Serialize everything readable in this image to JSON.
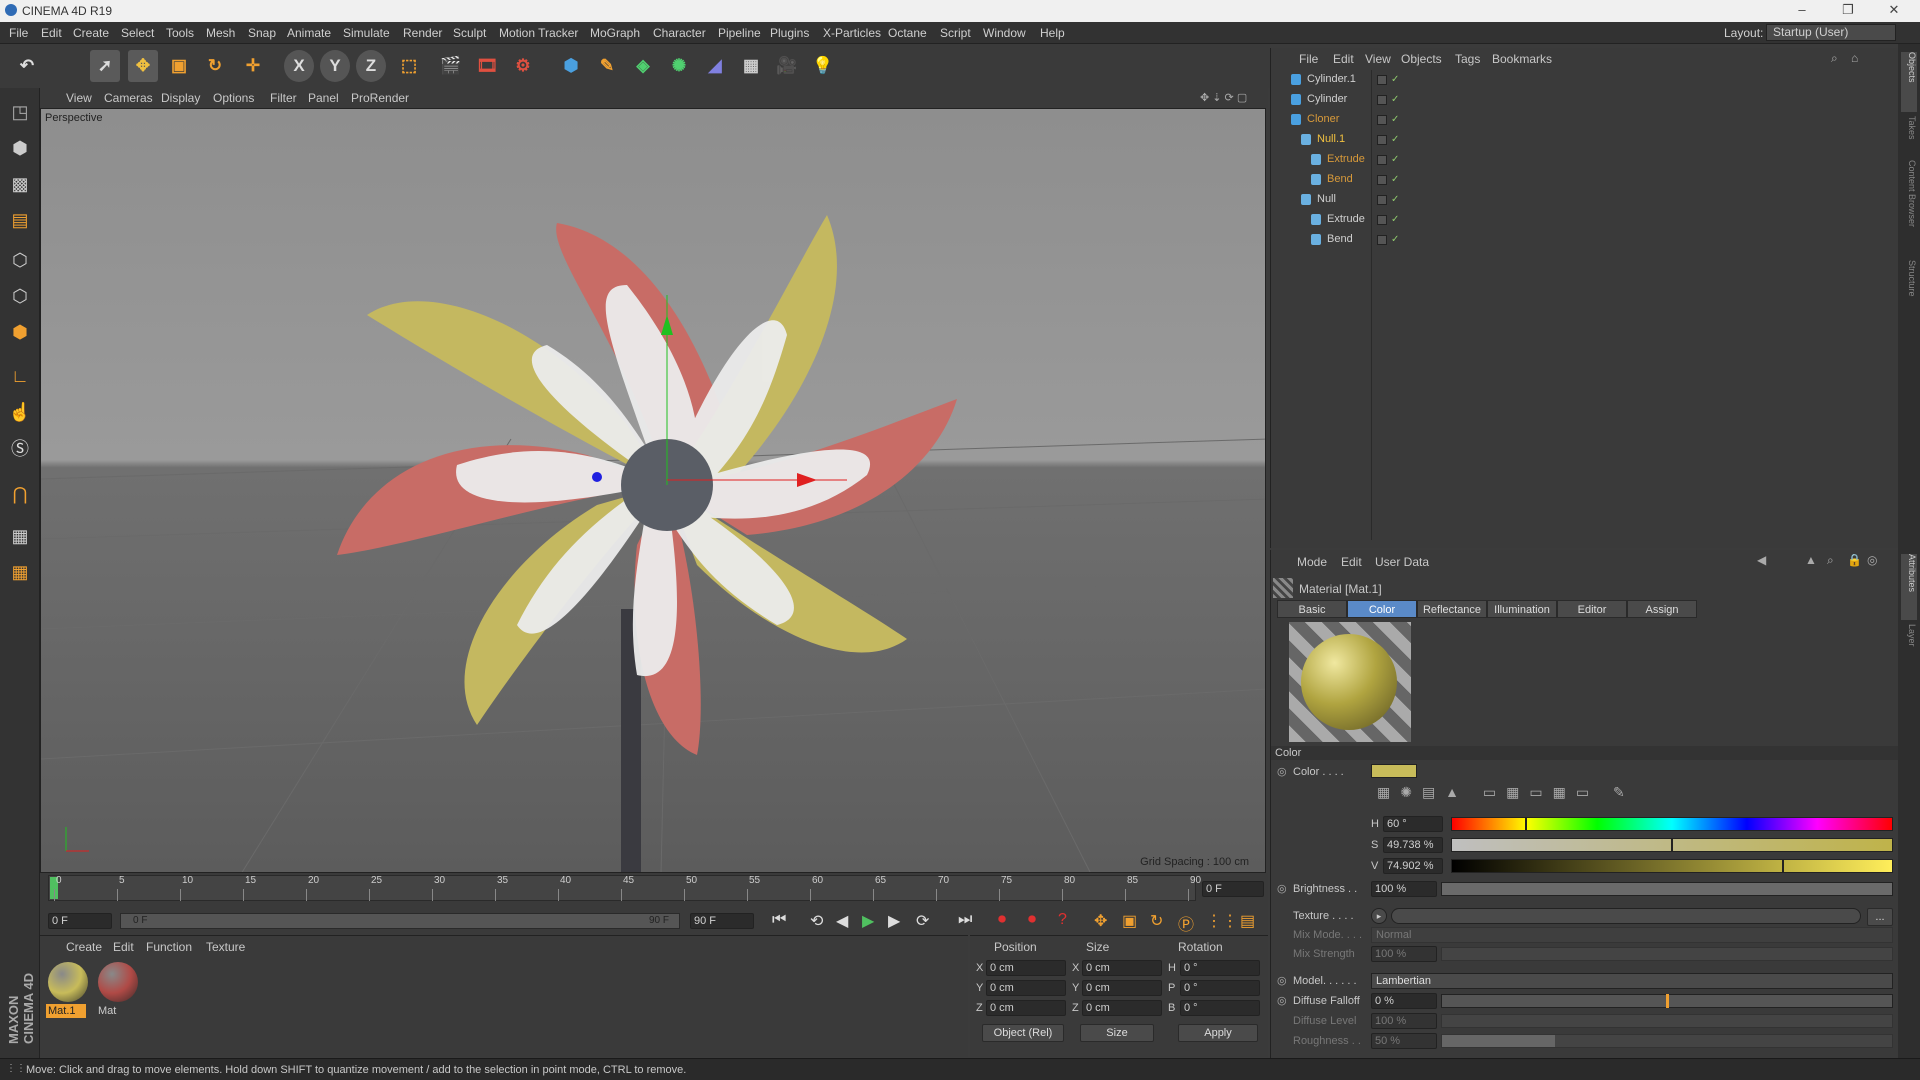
{
  "title": "CINEMA 4D R19",
  "window_controls": [
    "–",
    "❐",
    "✕"
  ],
  "menu": [
    "File",
    "Edit",
    "Create",
    "Select",
    "Tools",
    "Mesh",
    "Snap",
    "Animate",
    "Simulate",
    "Render",
    "Sculpt",
    "Motion Tracker",
    "MoGraph",
    "Character",
    "Pipeline",
    "Plugins",
    "X-Particles",
    "Octane",
    "Script",
    "Window",
    "Help"
  ],
  "layout": {
    "label": "Layout:",
    "value": "Startup (User)"
  },
  "viewport": {
    "menu": [
      "View",
      "Cameras",
      "Display",
      "Options",
      "Filter",
      "Panel",
      "ProRender"
    ],
    "camera_label": "Perspective",
    "grid_spacing": "Grid Spacing : 100 cm"
  },
  "timeline": {
    "ticks": [
      "0",
      "5",
      "10",
      "15",
      "20",
      "25",
      "30",
      "35",
      "40",
      "45",
      "50",
      "55",
      "60",
      "65",
      "70",
      "75",
      "80",
      "85",
      "90"
    ],
    "current_frame": "0 F",
    "start": "0 F",
    "range_start": "0 F",
    "range_end": "90 F",
    "end": "90 F"
  },
  "materials": {
    "menu": [
      "Create",
      "Edit",
      "Function",
      "Texture"
    ],
    "items": [
      {
        "name": "Mat.1",
        "color": "#c8bc5a",
        "selected": true
      },
      {
        "name": "Mat",
        "color": "#b04a46",
        "selected": false
      }
    ]
  },
  "coords": {
    "headers": [
      "Position",
      "Size",
      "Rotation"
    ],
    "rows": [
      {
        "axis": "X",
        "pos": "0 cm",
        "saxis": "X",
        "size": "0 cm",
        "raxis": "H",
        "rot": "0 °"
      },
      {
        "axis": "Y",
        "pos": "0 cm",
        "saxis": "Y",
        "size": "0 cm",
        "raxis": "P",
        "rot": "0 °"
      },
      {
        "axis": "Z",
        "pos": "0 cm",
        "saxis": "Z",
        "size": "0 cm",
        "raxis": "B",
        "rot": "0 °"
      }
    ],
    "mode": "Object (Rel)",
    "size_mode": "Size",
    "apply": "Apply"
  },
  "objects": {
    "menu": [
      "File",
      "Edit",
      "View",
      "Objects",
      "Tags",
      "Bookmarks"
    ],
    "rows": [
      {
        "name": "Cylinder.1",
        "indent": 0,
        "color": "#d0d0d0"
      },
      {
        "name": "Cylinder",
        "indent": 0,
        "color": "#d0d0d0"
      },
      {
        "name": "Cloner",
        "indent": 0,
        "color": "#d89a3a"
      },
      {
        "name": "Null.1",
        "indent": 1,
        "color": "#f0c040"
      },
      {
        "name": "Extrude",
        "indent": 2,
        "color": "#d89a3a"
      },
      {
        "name": "Bend",
        "indent": 2,
        "color": "#d89a3a"
      },
      {
        "name": "Null",
        "indent": 1,
        "color": "#d0d0d0"
      },
      {
        "name": "Extrude",
        "indent": 2,
        "color": "#d0d0d0"
      },
      {
        "name": "Bend",
        "indent": 2,
        "color": "#d0d0d0"
      }
    ]
  },
  "attributes": {
    "menu": [
      "Mode",
      "Edit",
      "User Data"
    ],
    "material_title": "Material [Mat.1]",
    "tabs": [
      "Basic",
      "Color",
      "Reflectance",
      "Illumination",
      "Editor",
      "Assign"
    ],
    "active_tab": "Color",
    "section": "Color",
    "color_label": "Color . . . .",
    "swatch": "#c8bc5a",
    "h": {
      "label": "H",
      "value": "60 °",
      "fraction": 0.167
    },
    "s": {
      "label": "S",
      "value": "49.738 %",
      "fraction": 0.497
    },
    "v": {
      "label": "V",
      "value": "74.902 %",
      "fraction": 0.749
    },
    "brightness": {
      "label": "Brightness . .",
      "value": "100 %",
      "fraction": 1.0
    },
    "texture": {
      "label": "Texture . . . ."
    },
    "mix_mode": {
      "label": "Mix Mode. . . .",
      "value": "Normal"
    },
    "mix_strength": {
      "label": "Mix Strength",
      "value": "100 %"
    },
    "model": {
      "label": "Model. . . . . .",
      "value": "Lambertian"
    },
    "diffuse_falloff": {
      "label": "Diffuse Falloff",
      "value": "0 %",
      "fraction": 0.5
    },
    "diffuse_level": {
      "label": "Diffuse Level",
      "value": "100 %"
    },
    "roughness": {
      "label": "Roughness . .",
      "value": "50 %",
      "fraction": 0.25
    }
  },
  "side_tabs": [
    "Objects",
    "Takes",
    "Content Browser",
    "Structure"
  ],
  "attr_side_tabs": [
    "Attributes",
    "Layer"
  ],
  "brand": "MAXON CINEMA 4D",
  "status": "Move: Click and drag to move elements. Hold down SHIFT to quantize movement / add to the selection in point mode, CTRL to remove."
}
